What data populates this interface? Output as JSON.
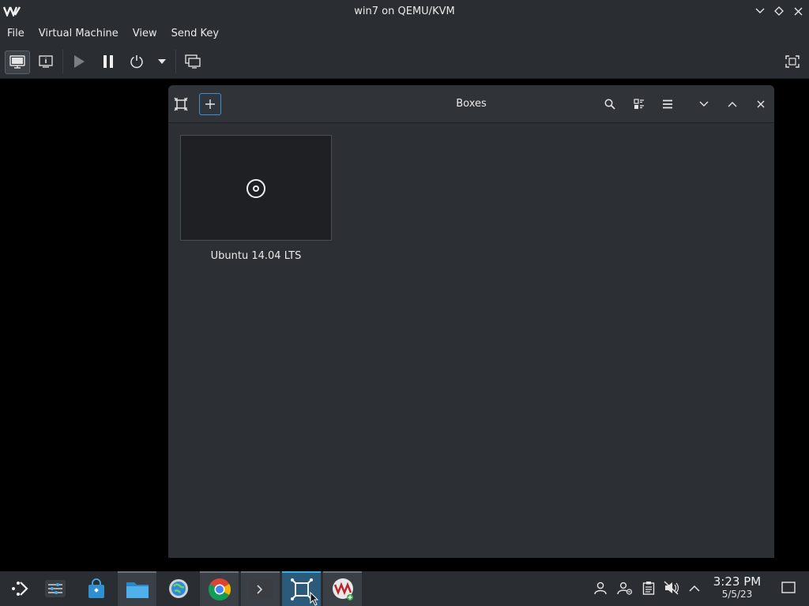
{
  "window": {
    "title": "win7 on QEMU/KVM"
  },
  "menu": {
    "items": [
      "File",
      "Virtual Machine",
      "View",
      "Send Key"
    ]
  },
  "boxes": {
    "title": "Boxes",
    "vms": [
      {
        "label": "Ubuntu 14.04 LTS"
      }
    ]
  },
  "taskbar": {
    "time": "3:23 PM",
    "date": "5/5/23"
  },
  "colors": {
    "chrome": "#2a2e32",
    "accent": "#3daee9",
    "boxes_bg": "#2c2f33"
  },
  "icons": {
    "toolbar": [
      "monitor-icon",
      "info-icon",
      "play-icon",
      "pause-icon",
      "power-icon",
      "dropdown-arrow-icon",
      "screens-icon",
      "fullscreen-icon"
    ],
    "boxes_header": [
      "boxes-logo-icon",
      "plus-icon",
      "search-icon",
      "select-icon",
      "hamburger-menu-icon",
      "minimize-icon",
      "maximize-icon",
      "close-icon"
    ],
    "tray": [
      "user-icon",
      "user-status-icon",
      "clipboard-icon",
      "volume-muted-icon",
      "chevron-up-icon",
      "show-desktop-icon"
    ]
  }
}
